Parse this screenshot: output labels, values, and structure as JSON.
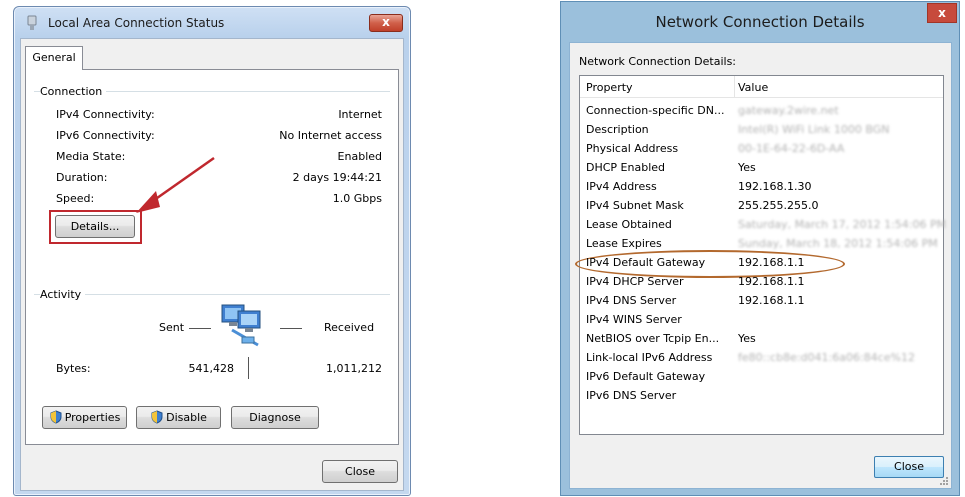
{
  "status_window": {
    "title": "Local Area Connection Status",
    "close_label": "x",
    "tab": "General",
    "connection": {
      "heading": "Connection",
      "rows": [
        {
          "label": "IPv4 Connectivity:",
          "value": "Internet"
        },
        {
          "label": "IPv6 Connectivity:",
          "value": "No Internet access"
        },
        {
          "label": "Media State:",
          "value": "Enabled"
        },
        {
          "label": "Duration:",
          "value": "2 days 19:44:21"
        },
        {
          "label": "Speed:",
          "value": "1.0 Gbps"
        }
      ],
      "details_button": "Details..."
    },
    "activity": {
      "heading": "Activity",
      "sent_label": "Sent",
      "received_label": "Received",
      "bytes_label": "Bytes:",
      "bytes_sent": "541,428",
      "bytes_received": "1,011,212"
    },
    "buttons": {
      "properties": "Properties",
      "disable": "Disable",
      "diagnose": "Diagnose",
      "close": "Close"
    },
    "annotation_color": "#c0282e"
  },
  "details_window": {
    "title": "Network Connection Details",
    "close_label": "x",
    "caption": "Network Connection Details:",
    "columns": {
      "property": "Property",
      "value": "Value"
    },
    "rows": [
      {
        "property": "Connection-specific DN...",
        "value": "gateway.2wire.net",
        "blurred": true
      },
      {
        "property": "Description",
        "value": "Intel(R) WiFi Link 1000 BGN",
        "blurred": true
      },
      {
        "property": "Physical Address",
        "value": "00-1E-64-22-6D-AA",
        "blurred": true
      },
      {
        "property": "DHCP Enabled",
        "value": "Yes",
        "blurred": false
      },
      {
        "property": "IPv4 Address",
        "value": "192.168.1.30",
        "blurred": false
      },
      {
        "property": "IPv4 Subnet Mask",
        "value": "255.255.255.0",
        "blurred": false
      },
      {
        "property": "Lease Obtained",
        "value": "Saturday, March 17, 2012 1:54:06 PM",
        "blurred": true
      },
      {
        "property": "Lease Expires",
        "value": "Sunday, March 18, 2012 1:54:06 PM",
        "blurred": true
      },
      {
        "property": "IPv4 Default Gateway",
        "value": "192.168.1.1",
        "blurred": false,
        "circled": true
      },
      {
        "property": "IPv4 DHCP Server",
        "value": "192.168.1.1",
        "blurred": false
      },
      {
        "property": "IPv4 DNS Server",
        "value": "192.168.1.1",
        "blurred": false
      },
      {
        "property": "IPv4 WINS Server",
        "value": "",
        "blurred": false
      },
      {
        "property": "NetBIOS over Tcpip En...",
        "value": "Yes",
        "blurred": false
      },
      {
        "property": "Link-local IPv6 Address",
        "value": "fe80::cb8e:d041:6a06:84ce%12",
        "blurred": true
      },
      {
        "property": "IPv6 Default Gateway",
        "value": "",
        "blurred": false
      },
      {
        "property": "IPv6 DNS Server",
        "value": "",
        "blurred": false
      }
    ],
    "close_button": "Close",
    "annotation_color": "#b3692e"
  }
}
